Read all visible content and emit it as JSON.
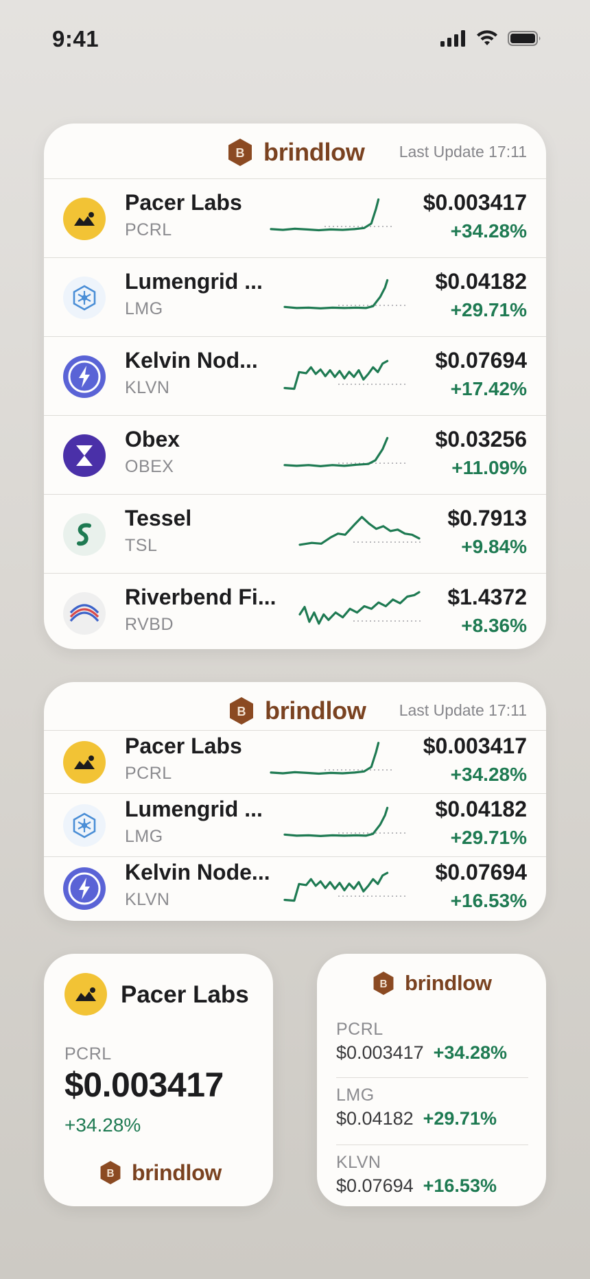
{
  "status": {
    "time": "9:41",
    "signal_icon": "cellular-signal-icon",
    "wifi_icon": "wifi-icon",
    "battery_icon": "battery-icon"
  },
  "brand": {
    "name": "brindlow",
    "mark": "B",
    "color": "#7a4220"
  },
  "colors": {
    "positive": "#1e7a52",
    "sparkline": "#1e7a52"
  },
  "large_widget": {
    "last_update": "Last Update 17:11",
    "rows": [
      {
        "name": "Pacer Labs",
        "ticker": "PCRL",
        "price": "$0.003417",
        "change": "+34.28%",
        "icon": "pacer-labs-icon"
      },
      {
        "name": "Lumengrid ...",
        "ticker": "LMG",
        "price": "$0.04182",
        "change": "+29.71%",
        "icon": "lumengrid-icon"
      },
      {
        "name": "Kelvin Nod...",
        "ticker": "KLVN",
        "price": "$0.07694",
        "change": "+17.42%",
        "icon": "kelvin-node-icon"
      },
      {
        "name": "Obex",
        "ticker": "OBEX",
        "price": "$0.03256",
        "change": "+11.09%",
        "icon": "obex-icon"
      },
      {
        "name": "Tessel",
        "ticker": "TSL",
        "price": "$0.7913",
        "change": "+9.84%",
        "icon": "tessel-icon"
      },
      {
        "name": "Riverbend Fi...",
        "ticker": "RVBD",
        "price": "$1.4372",
        "change": "+8.36%",
        "icon": "riverbend-icon"
      }
    ]
  },
  "medium_widget": {
    "last_update": "Last Update 17:11",
    "rows": [
      {
        "name": "Pacer Labs",
        "ticker": "PCRL",
        "price": "$0.003417",
        "change": "+34.28%",
        "icon": "pacer-labs-icon"
      },
      {
        "name": "Lumengrid ...",
        "ticker": "LMG",
        "price": "$0.04182",
        "change": "+29.71%",
        "icon": "lumengrid-icon"
      },
      {
        "name": "Kelvin Node...",
        "ticker": "KLVN",
        "price": "$0.07694",
        "change": "+16.53%",
        "icon": "kelvin-node-icon"
      }
    ]
  },
  "small_single": {
    "name": "Pacer Labs",
    "ticker": "PCRL",
    "price": "$0.003417",
    "change": "+34.28%",
    "icon": "pacer-labs-icon"
  },
  "small_list": {
    "items": [
      {
        "ticker": "PCRL",
        "price": "$0.003417",
        "change": "+34.28%"
      },
      {
        "ticker": "LMG",
        "price": "$0.04182",
        "change": "+29.71%"
      },
      {
        "ticker": "KLVN",
        "price": "$0.07694",
        "change": "+16.53%"
      }
    ]
  }
}
